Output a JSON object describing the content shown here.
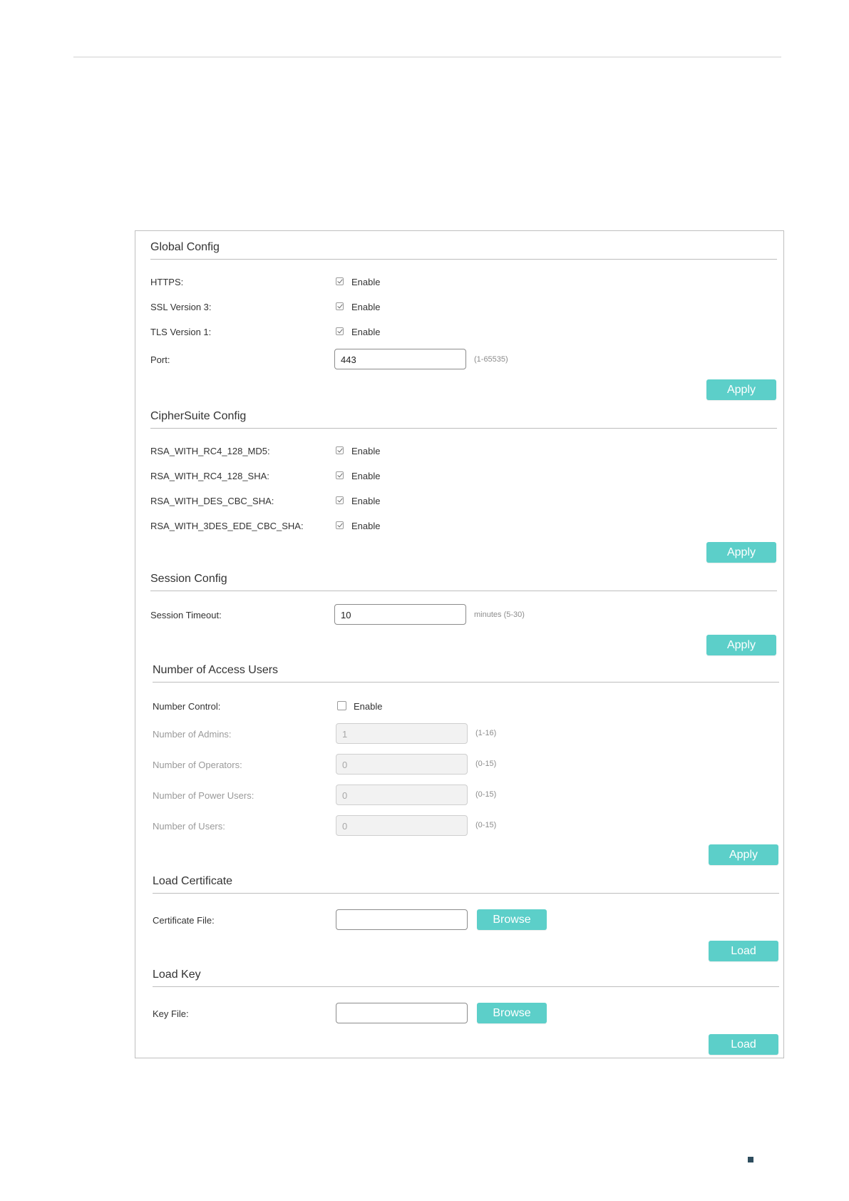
{
  "global": {
    "title": "Global Config",
    "https_label": "HTTPS:",
    "ssl3_label": "SSL Version 3:",
    "tls1_label": "TLS Version 1:",
    "enable": "Enable",
    "port_label": "Port:",
    "port_value": "443",
    "port_hint": "(1-65535)",
    "apply": "Apply",
    "checked": {
      "https": true,
      "ssl3": true,
      "tls1": true
    }
  },
  "cipher": {
    "title": "CipherSuite Config",
    "items": [
      {
        "label": "RSA_WITH_RC4_128_MD5:",
        "checked": true
      },
      {
        "label": "RSA_WITH_RC4_128_SHA:",
        "checked": true
      },
      {
        "label": "RSA_WITH_DES_CBC_SHA:",
        "checked": true
      },
      {
        "label": "RSA_WITH_3DES_EDE_CBC_SHA:",
        "checked": true
      }
    ],
    "enable": "Enable",
    "apply": "Apply"
  },
  "session": {
    "title": "Session Config",
    "timeout_label": "Session Timeout:",
    "timeout_value": "10",
    "timeout_hint": "minutes (5-30)",
    "apply": "Apply"
  },
  "access": {
    "title": "Number of Access Users",
    "control_label": "Number Control:",
    "control_checked": false,
    "enable": "Enable",
    "admins_label": "Number of Admins:",
    "admins_value": "1",
    "admins_hint": "(1-16)",
    "operators_label": "Number of Operators:",
    "operators_value": "0",
    "operators_hint": "(0-15)",
    "power_label": "Number of Power Users:",
    "power_value": "0",
    "power_hint": "(0-15)",
    "users_label": "Number of Users:",
    "users_value": "0",
    "users_hint": "(0-15)",
    "apply": "Apply"
  },
  "cert": {
    "title": "Load Certificate",
    "file_label": "Certificate File:",
    "browse": "Browse",
    "load": "Load"
  },
  "key": {
    "title": "Load Key",
    "file_label": "Key File:",
    "browse": "Browse",
    "load": "Load"
  },
  "colors": {
    "accent": "#5ccfc9",
    "footer_mark": "#2e4d5e"
  }
}
